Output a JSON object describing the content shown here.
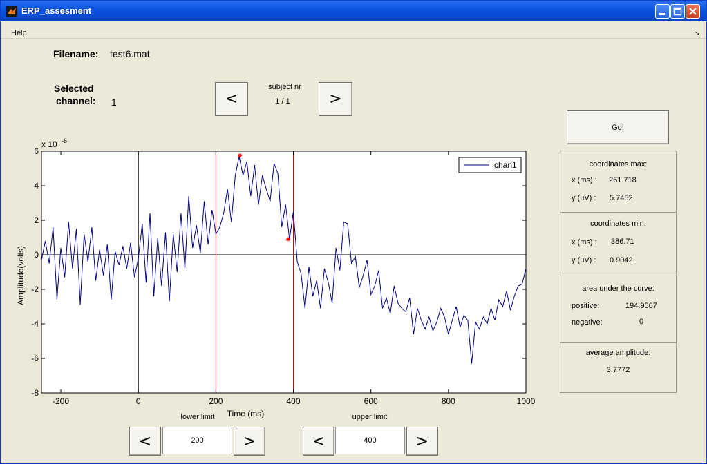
{
  "window": {
    "title": "ERP_assesment"
  },
  "menu": {
    "help": "Help",
    "corner": "↘"
  },
  "file": {
    "label": "Filename:",
    "value": "test6.mat"
  },
  "channel": {
    "label_line1": "Selected",
    "label_line2": "channel:",
    "value": "1"
  },
  "subject": {
    "label": "subject nr",
    "value": "1 / 1",
    "prev": "<",
    "next": ">"
  },
  "go_button": "Go!",
  "limits": {
    "lower_label": "lower limit",
    "lower_value": "200",
    "upper_label": "upper limit",
    "upper_value": "400",
    "prev": "<",
    "next": ">"
  },
  "results": {
    "max": {
      "title": "coordinates max:",
      "x_label": "x (ms) :",
      "x_value": "261.718",
      "y_label": "y (uV) :",
      "y_value": "5.7452"
    },
    "min": {
      "title": "coordinates min:",
      "x_label": "x (ms) :",
      "x_value": "386.71",
      "y_label": "y (uV) :",
      "y_value": "0.9042"
    },
    "area": {
      "title": "area under the curve:",
      "pos_label": "positive:",
      "pos_value": "194.9567",
      "neg_label": "negative:",
      "neg_value": "0"
    },
    "avg": {
      "title": "average amplitude:",
      "value": "3.7772"
    }
  },
  "colors": {
    "signal": "#000080",
    "marker": "#ff0000",
    "limit_lines": "#cc0000"
  },
  "chart_data": {
    "type": "line",
    "xlabel": "Time (ms)",
    "ylabel": "Amplitude(volts)",
    "exponent_label": "x 10",
    "exponent_power": "-6",
    "xlim": [
      -250,
      1000
    ],
    "ylim": [
      -8,
      6
    ],
    "xticks": [
      "-200",
      "0",
      "200",
      "400",
      "600",
      "800",
      "1000"
    ],
    "yticks": [
      "6",
      "4",
      "2",
      "0",
      "-2",
      "-4",
      "-6",
      "-8"
    ],
    "legend": "chan1",
    "limit_lines_x": [
      200,
      400
    ],
    "max_point": [
      261.718,
      5.7452
    ],
    "min_point": [
      386.71,
      0.9042
    ],
    "series": [
      {
        "name": "chan1",
        "x": [
          -250,
          -240,
          -230,
          -220,
          -210,
          -200,
          -190,
          -180,
          -170,
          -160,
          -150,
          -140,
          -130,
          -120,
          -110,
          -100,
          -90,
          -80,
          -70,
          -60,
          -50,
          -40,
          -30,
          -20,
          -10,
          0,
          10,
          20,
          30,
          40,
          50,
          60,
          70,
          80,
          90,
          100,
          110,
          120,
          130,
          140,
          150,
          160,
          170,
          180,
          190,
          200,
          210,
          220,
          230,
          240,
          250,
          260,
          270,
          280,
          290,
          300,
          310,
          320,
          330,
          340,
          350,
          360,
          370,
          380,
          390,
          400,
          410,
          420,
          430,
          440,
          450,
          460,
          470,
          480,
          490,
          500,
          510,
          520,
          530,
          540,
          550,
          560,
          570,
          580,
          590,
          600,
          610,
          620,
          630,
          640,
          650,
          660,
          670,
          680,
          690,
          700,
          710,
          720,
          730,
          740,
          750,
          760,
          770,
          780,
          790,
          800,
          810,
          820,
          830,
          840,
          850,
          860,
          870,
          880,
          890,
          900,
          910,
          920,
          930,
          940,
          950,
          960,
          970,
          980,
          990,
          1000
        ],
        "y": [
          -0.3,
          0.8,
          -0.5,
          1.6,
          -2.6,
          0.4,
          -1.3,
          1.9,
          -0.8,
          1.5,
          -2.9,
          1.2,
          -0.4,
          1.6,
          -1.5,
          0.3,
          -1.2,
          0.6,
          -2.6,
          0.2,
          -0.6,
          0.5,
          -0.8,
          0.7,
          -1.3,
          -0.2,
          1.8,
          -1.6,
          2.4,
          -2.4,
          1.0,
          -1.8,
          1.3,
          -2.7,
          1.2,
          -1.0,
          2.4,
          -0.8,
          3.4,
          0.4,
          1.7,
          0.1,
          3.1,
          0.6,
          2.6,
          1.2,
          1.6,
          2.4,
          3.8,
          1.9,
          4.6,
          5.7,
          4.6,
          5.4,
          3.4,
          5.2,
          2.9,
          4.6,
          3.8,
          3.1,
          5.3,
          4.7,
          1.6,
          2.9,
          0.9,
          2.5,
          -0.4,
          -1.1,
          -3.1,
          -0.7,
          -2.4,
          -1.5,
          -3.1,
          -0.8,
          -1.6,
          -2.8,
          0.4,
          -0.9,
          1.9,
          1.8,
          -0.5,
          -0.1,
          -1.9,
          -1.2,
          -0.3,
          -2.3,
          -1.8,
          -0.9,
          -3.1,
          -2.5,
          -3.4,
          -1.8,
          -2.8,
          -3.1,
          -3.3,
          -2.5,
          -4.6,
          -3.1,
          -3.8,
          -4.3,
          -3.6,
          -4.4,
          -3.9,
          -3.1,
          -3.6,
          -4.6,
          -3.8,
          -3.0,
          -4.2,
          -3.5,
          -3.8,
          -6.3,
          -3.9,
          -4.3,
          -3.6,
          -4.0,
          -3.1,
          -3.8,
          -2.6,
          -3.0,
          -2.1,
          -3.2,
          -2.4,
          -1.8,
          -1.7,
          -0.8
        ]
      }
    ]
  }
}
